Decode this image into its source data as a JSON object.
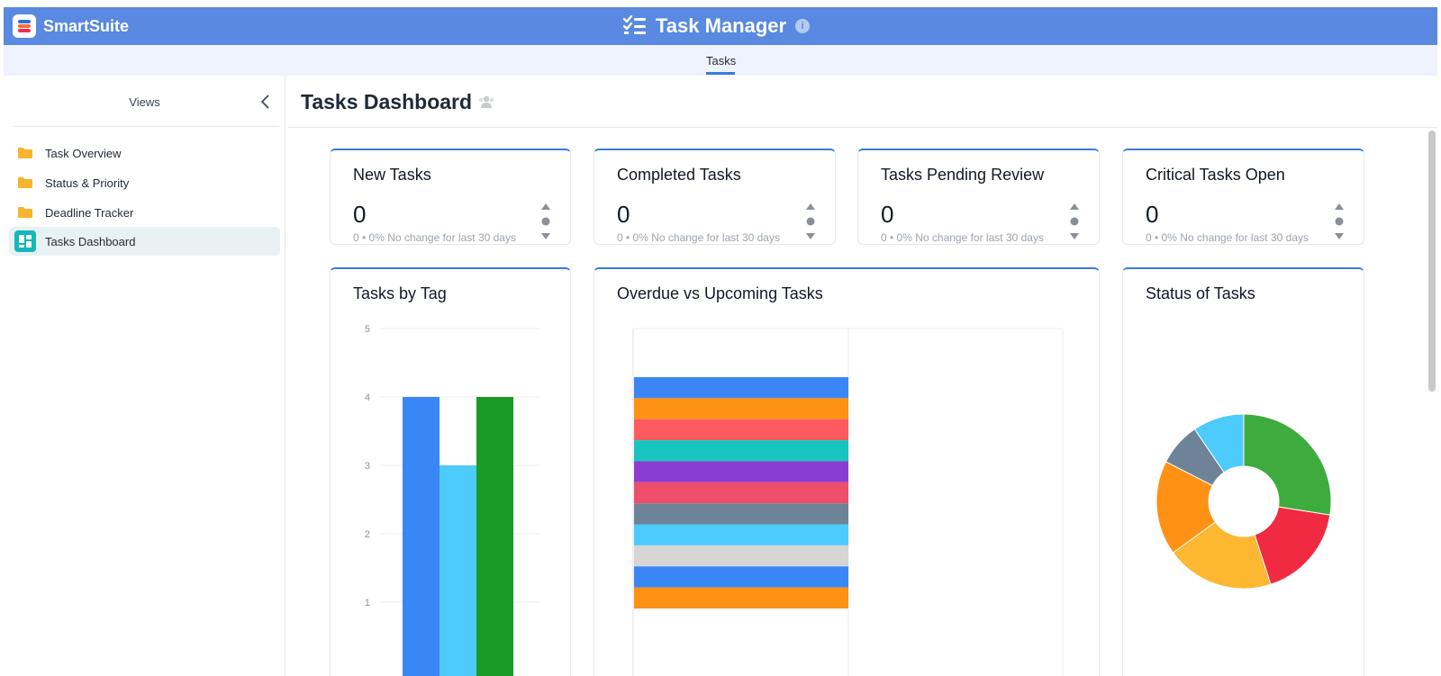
{
  "header": {
    "brand": "SmartSuite",
    "app_title": "Task Manager"
  },
  "tabs": [
    {
      "label": "Tasks"
    }
  ],
  "sidebar": {
    "title": "Views",
    "items": [
      {
        "label": "Task Overview"
      },
      {
        "label": "Status & Priority"
      },
      {
        "label": "Deadline Tracker"
      },
      {
        "label": "Tasks Dashboard"
      }
    ]
  },
  "dashboard": {
    "title": "Tasks Dashboard",
    "metrics": [
      {
        "title": "New Tasks",
        "value": "0",
        "sub": "0 • 0%  No change for last 30 days"
      },
      {
        "title": "Completed Tasks",
        "value": "0",
        "sub": "0 • 0%  No change for last 30 days"
      },
      {
        "title": "Tasks Pending Review",
        "value": "0",
        "sub": "0 • 0%  No change for last 30 days"
      },
      {
        "title": "Critical Tasks Open",
        "value": "0",
        "sub": "0 • 0%  No change for last 30 days"
      }
    ],
    "charts": [
      {
        "title": "Tasks by Tag"
      },
      {
        "title": "Overdue vs Upcoming Tasks"
      },
      {
        "title": "Status of Tasks"
      }
    ]
  },
  "colors": {
    "topbar": "#5989e0",
    "accent": "#3a7be0",
    "active_item": "#e9f2f2",
    "folder": "#f6b52c"
  },
  "chart_data": [
    {
      "type": "bar",
      "title": "Tasks by Tag",
      "ylim": [
        0,
        5
      ],
      "yticks": [
        "1",
        "2",
        "3",
        "4",
        "5"
      ],
      "series": [
        {
          "values": [
            4
          ],
          "color": "#3a86f7"
        },
        {
          "values": [
            3
          ],
          "color": "#4dcbfb"
        },
        {
          "values": [
            4
          ],
          "color": "#1a9a27"
        }
      ]
    },
    {
      "type": "bar",
      "orientation": "horizontal",
      "stacked": true,
      "title": "Overdue vs Upcoming Tasks",
      "series": [
        {
          "values": [
            1
          ],
          "color": "#3a86f7"
        },
        {
          "values": [
            1
          ],
          "color": "#ff9214"
        },
        {
          "values": [
            1
          ],
          "color": "#ff5a5f"
        },
        {
          "values": [
            1
          ],
          "color": "#19c4c0"
        },
        {
          "values": [
            1
          ],
          "color": "#8a3dd1"
        },
        {
          "values": [
            1
          ],
          "color": "#ef4d6c"
        },
        {
          "values": [
            1
          ],
          "color": "#6e8298"
        },
        {
          "values": [
            1
          ],
          "color": "#4dcbfb"
        },
        {
          "values": [
            1
          ],
          "color": "#d6d6d6"
        },
        {
          "values": [
            1
          ],
          "color": "#3a86f7"
        },
        {
          "values": [
            1
          ],
          "color": "#ff9214"
        }
      ]
    },
    {
      "type": "pie",
      "title": "Status of Tasks",
      "donut": true,
      "slices": [
        {
          "value": 27.5,
          "color": "#3dab3e"
        },
        {
          "value": 17.5,
          "color": "#f02a41"
        },
        {
          "value": 20,
          "color": "#fdb731"
        },
        {
          "value": 17.5,
          "color": "#ff9214"
        },
        {
          "value": 8,
          "color": "#6e8298"
        },
        {
          "value": 9.5,
          "color": "#4dcbfb"
        }
      ]
    }
  ]
}
